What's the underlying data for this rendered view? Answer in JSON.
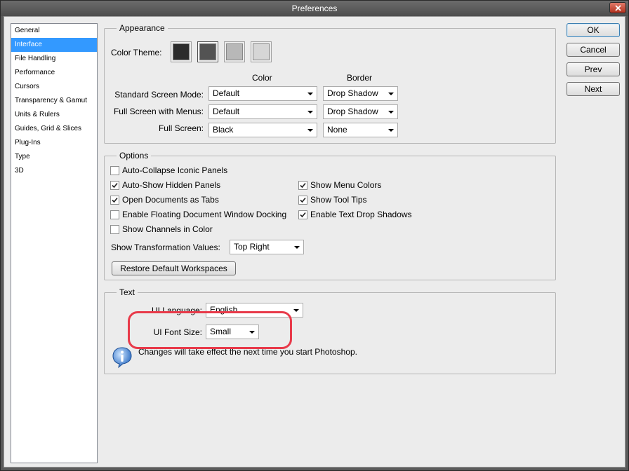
{
  "window": {
    "title": "Preferences"
  },
  "nav": {
    "items": [
      "General",
      "Interface",
      "File Handling",
      "Performance",
      "Cursors",
      "Transparency & Gamut",
      "Units & Rulers",
      "Guides, Grid & Slices",
      "Plug-Ins",
      "Type",
      "3D"
    ],
    "selected": "Interface"
  },
  "appearance": {
    "title": "Appearance",
    "color_theme_label": "Color Theme:",
    "themes": [
      "#2b2b2b",
      "#535353",
      "#b8b8b8",
      "#d6d6d6"
    ],
    "selected_theme_index": 1,
    "col_color": "Color",
    "col_border": "Border",
    "rows": [
      {
        "label": "Standard Screen Mode:",
        "color": "Default",
        "border": "Drop Shadow"
      },
      {
        "label": "Full Screen with Menus:",
        "color": "Default",
        "border": "Drop Shadow"
      },
      {
        "label": "Full Screen:",
        "color": "Black",
        "border": "None"
      }
    ]
  },
  "options": {
    "title": "Options",
    "left_checks": [
      {
        "label": "Auto-Collapse Iconic Panels",
        "checked": false
      },
      {
        "label": "Auto-Show Hidden Panels",
        "checked": true
      },
      {
        "label": "Open Documents as Tabs",
        "checked": true
      },
      {
        "label": "Enable Floating Document Window Docking",
        "checked": false
      },
      {
        "label": "Show Channels in Color",
        "checked": false
      }
    ],
    "right_checks": [
      {
        "label": "Show Menu Colors",
        "checked": true
      },
      {
        "label": "Show Tool Tips",
        "checked": true
      },
      {
        "label": "Enable Text Drop Shadows",
        "checked": true
      }
    ],
    "transform_label": "Show Transformation Values:",
    "transform_value": "Top Right",
    "restore_label": "Restore Default Workspaces"
  },
  "text_group": {
    "title": "Text",
    "ui_language_label": "UI Language:",
    "ui_language_value": "English",
    "ui_font_size_label": "UI Font Size:",
    "ui_font_size_value": "Small",
    "note": "Changes will take effect the next time you start Photoshop."
  },
  "buttons": {
    "ok": "OK",
    "cancel": "Cancel",
    "prev": "Prev",
    "next": "Next"
  },
  "annotation": {
    "highlight_color": "#e83a4a"
  }
}
